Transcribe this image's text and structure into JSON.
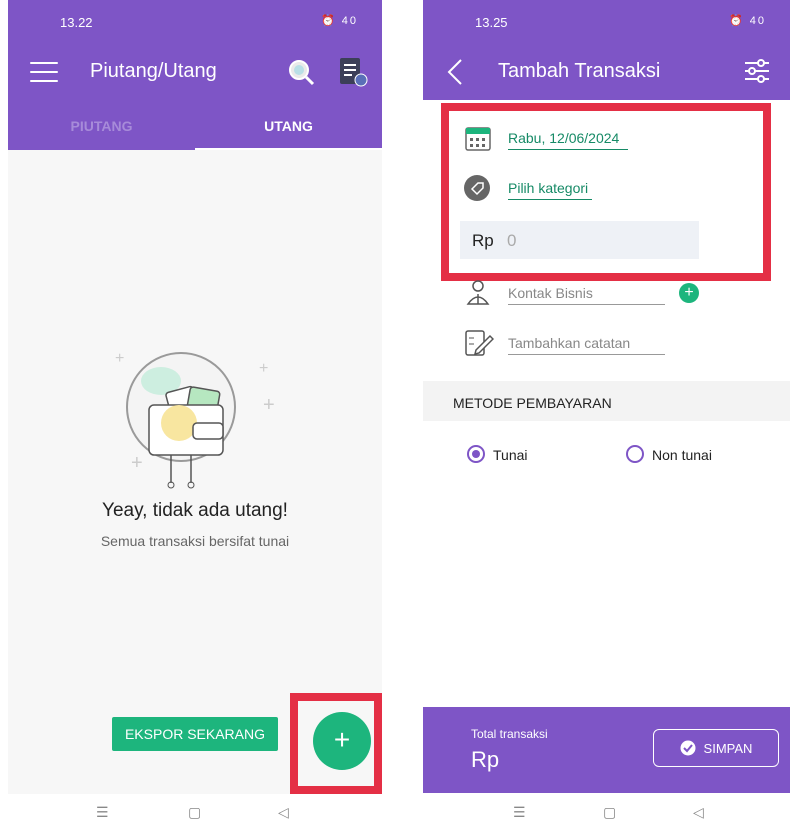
{
  "left_screen": {
    "status": {
      "time": "13.22",
      "icons": "⏰ 40"
    },
    "appbar": {
      "title": "Piutang/Utang"
    },
    "tabs": [
      {
        "label": "PIUTANG",
        "active": false
      },
      {
        "label": "UTANG",
        "active": true
      }
    ],
    "empty_state": {
      "title": "Yeay, tidak ada utang!",
      "subtitle": "Semua transaksi bersifat tunai"
    },
    "export_button": "EKSPOR SEKARANG",
    "fab": "+"
  },
  "right_screen": {
    "status": {
      "time": "13.25",
      "icons": "⏰ 40"
    },
    "appbar": {
      "title": "Tambah Transaksi"
    },
    "form": {
      "date": "Rabu, 12/06/2024",
      "category": "Pilih kategori",
      "currency": "Rp",
      "amount_placeholder": "0",
      "contact_placeholder": "Kontak Bisnis",
      "note_placeholder": "Tambahkan catatan"
    },
    "payment": {
      "section_title": "METODE PEMBAYARAN",
      "options": [
        {
          "label": "Tunai",
          "checked": true
        },
        {
          "label": "Non tunai",
          "checked": false
        }
      ]
    },
    "footer": {
      "total_label": "Total transaksi",
      "total_value": "Rp",
      "save": "SIMPAN"
    }
  },
  "colors": {
    "primary": "#7e55c6",
    "accent": "#1db57d",
    "highlight": "#e42f45"
  },
  "icons": [
    "menu-icon",
    "search-icon",
    "report-icon",
    "back-icon",
    "filter-icon",
    "calendar-icon",
    "tag-icon",
    "contact-icon",
    "note-icon",
    "plus-icon",
    "check-icon"
  ]
}
